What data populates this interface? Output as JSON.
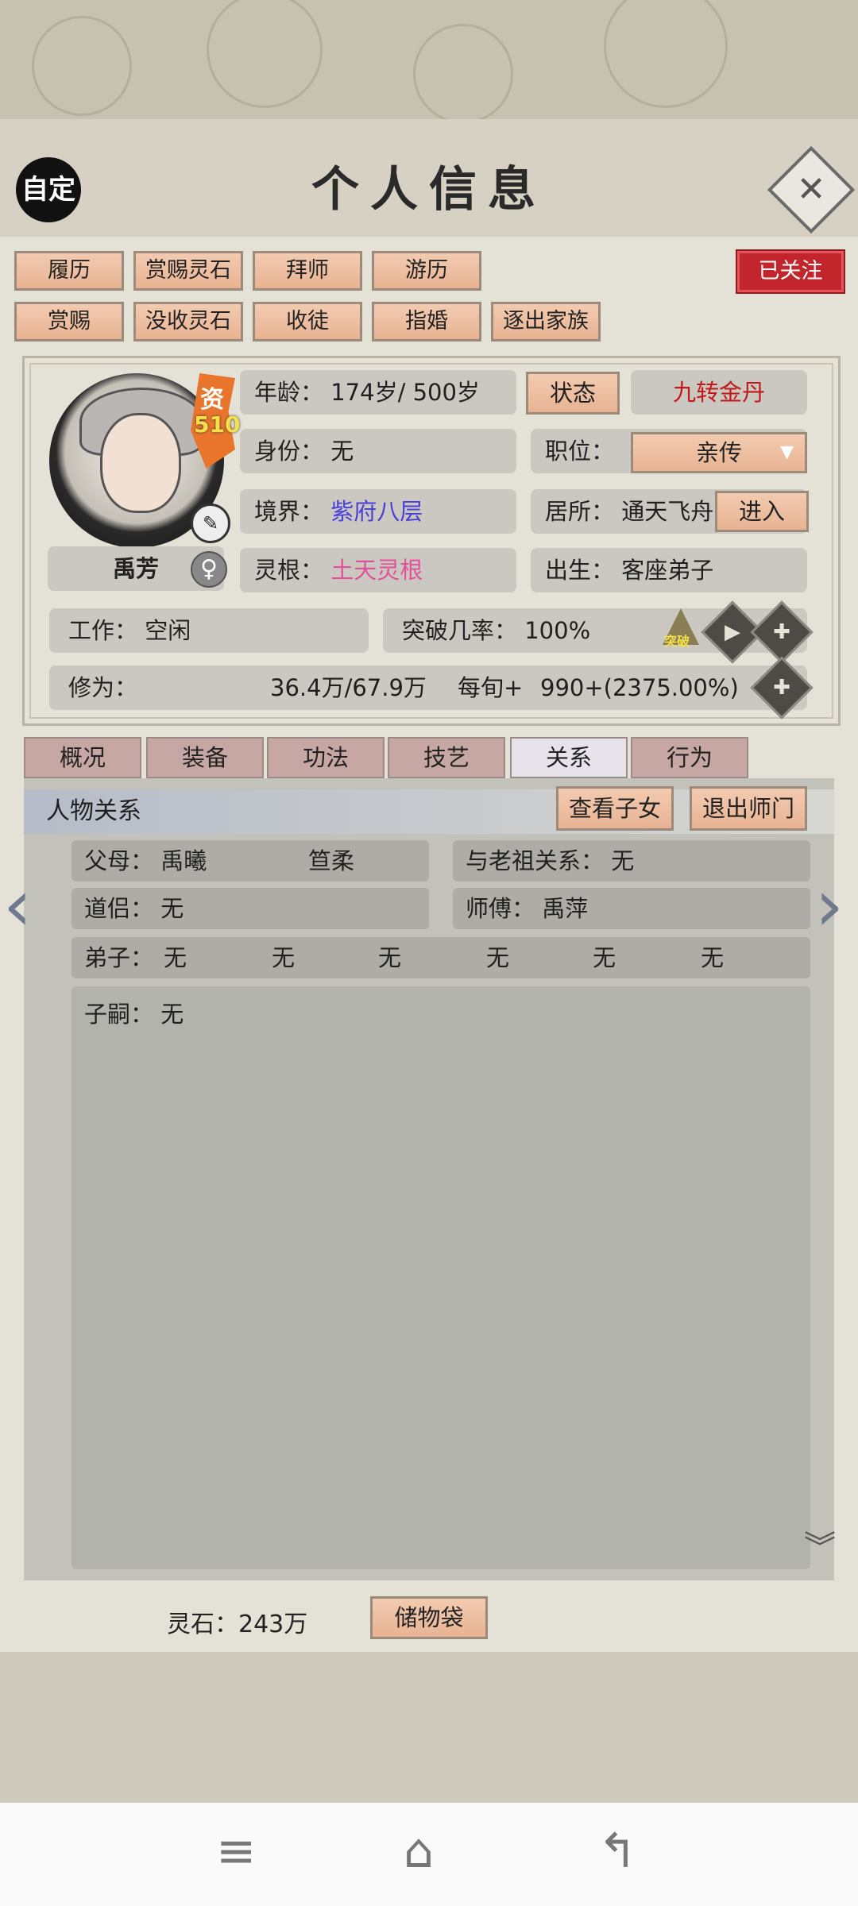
{
  "header": {
    "title": "个人信息",
    "auto_label": "自定",
    "close_label": "✕"
  },
  "actions_row1": [
    "履历",
    "赏赐灵石",
    "拜师",
    "游历"
  ],
  "actions_row2": [
    "赏赐",
    "没收灵石",
    "收徒",
    "指婚",
    "逐出家族"
  ],
  "follow_label": "已关注",
  "character": {
    "aptitude_label": "资",
    "aptitude_value": "510",
    "name": "禹芳",
    "age_label": "年龄：",
    "age_value": "174岁/ 500岁",
    "status_button": "状态",
    "status_value": "九转金丹",
    "identity_label": "身份：",
    "identity_value": "无",
    "position_label": "职位：",
    "position_value": "亲传",
    "realm_label": "境界：",
    "realm_value": "紫府八层",
    "residence_label": "居所：",
    "residence_value": "通天飞舟",
    "enter_button": "进入",
    "root_label": "灵根：",
    "root_value": "土天灵根",
    "birth_label": "出生：",
    "birth_value": "客座弟子",
    "work_label": "工作：",
    "work_value": "空闲",
    "breakthrough_label": "突破几率：",
    "breakthrough_value": "100%",
    "breakthrough_icon_text": "突破",
    "cultivation_label": "修为：",
    "cultivation_value": "36.4万/67.9万",
    "per_turn_label": "每旬+",
    "per_turn_value": "990+(2375.00%)"
  },
  "tabs": [
    "概况",
    "装备",
    "功法",
    "技艺",
    "关系",
    "行为"
  ],
  "active_tab": "关系",
  "relations": {
    "title": "人物关系",
    "view_children_button": "查看子女",
    "leave_master_button": "退出师门",
    "parents_label": "父母：",
    "parent_1": "禹曦",
    "parent_2": "笪柔",
    "ancestor_label": "与老祖关系：",
    "ancestor_value": "无",
    "partner_label": "道侣：",
    "partner_value": "无",
    "master_label": "师傅：",
    "master_value": "禹萍",
    "disciples_label": "弟子：",
    "disciples": [
      "无",
      "无",
      "无",
      "无",
      "无",
      "无"
    ],
    "heirs_label": "子嗣：",
    "heirs_value": "无"
  },
  "footer": {
    "spirit_stones_label": "灵石：",
    "spirit_stones_value": "243万",
    "storage_bag_button": "储物袋"
  },
  "colors": {
    "follow_red": "#c2262c",
    "realm_blue": "#4a3fd6",
    "root_pink": "#e3509a",
    "status_red": "#c21a1a"
  }
}
